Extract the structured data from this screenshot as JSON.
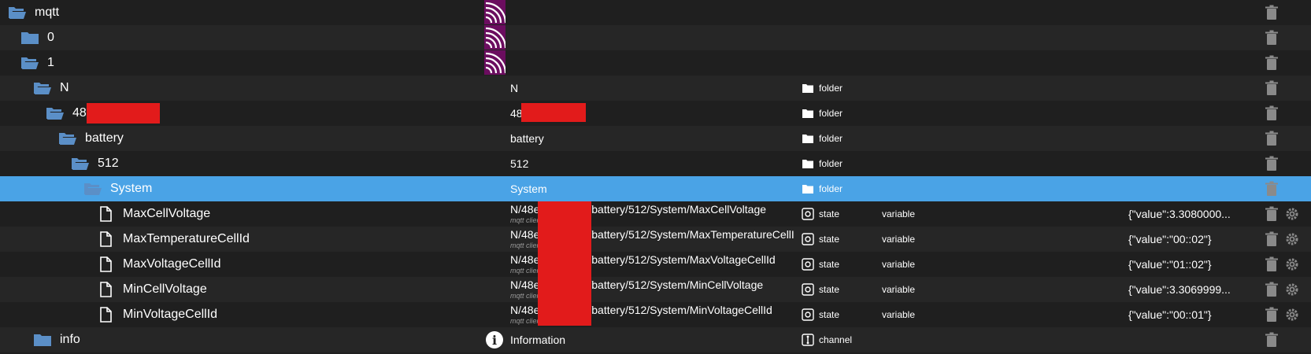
{
  "rows": [
    {
      "name": "mqtt",
      "indent": 0,
      "icon": "folder-open-icon",
      "id": "",
      "id_sub": "",
      "type": "",
      "role": "",
      "value": "",
      "badge": "mqtt"
    },
    {
      "name": "0",
      "indent": 1,
      "icon": "folder-closed-icon",
      "id": "",
      "id_sub": "",
      "type": "",
      "role": "",
      "value": "",
      "badge": "mqtt"
    },
    {
      "name": "1",
      "indent": 1,
      "icon": "folder-open-icon",
      "id": "",
      "id_sub": "",
      "type": "",
      "role": "",
      "value": "",
      "badge": "mqtt"
    },
    {
      "name": "N",
      "indent": 2,
      "icon": "folder-open-icon",
      "id": "N",
      "id_sub": "",
      "type": "folder",
      "role": "",
      "value": ""
    },
    {
      "name": "48",
      "indent": 3,
      "icon": "folder-open-icon",
      "id": "48",
      "id_sub": "",
      "type": "folder",
      "role": "",
      "value": ""
    },
    {
      "name": "battery",
      "indent": 4,
      "icon": "folder-open-icon",
      "id": "battery",
      "id_sub": "",
      "type": "folder",
      "role": "",
      "value": ""
    },
    {
      "name": "512",
      "indent": 5,
      "icon": "folder-open-icon",
      "id": "512",
      "id_sub": "",
      "type": "folder",
      "role": "",
      "value": ""
    },
    {
      "name": "System",
      "indent": 6,
      "icon": "folder-open-icon",
      "id": "System",
      "id_sub": "",
      "type": "folder",
      "role": "",
      "value": "",
      "selected": true
    },
    {
      "name": "MaxCellVoltage",
      "indent": 7,
      "icon": "file-icon",
      "id": "N/48e",
      "id_tail": "/battery/512/System/MaxCellVoltage",
      "id_sub": "mqtt client variable",
      "type": "state",
      "role": "variable",
      "value": "{\"value\":3.3080000..."
    },
    {
      "name": "MaxTemperatureCellId",
      "indent": 7,
      "icon": "file-icon",
      "id": "N/48e",
      "id_tail": "/battery/512/System/MaxTemperatureCellId",
      "id_sub": "mqtt client variable",
      "type": "state",
      "role": "variable",
      "value": "{\"value\":\"00::02\"}"
    },
    {
      "name": "MaxVoltageCellId",
      "indent": 7,
      "icon": "file-icon",
      "id": "N/48e",
      "id_tail": "/battery/512/System/MaxVoltageCellId",
      "id_sub": "mqtt client variable",
      "type": "state",
      "role": "variable",
      "value": "{\"value\":\"01::02\"}"
    },
    {
      "name": "MinCellVoltage",
      "indent": 7,
      "icon": "file-icon",
      "id": "N/48e",
      "id_tail": "/battery/512/System/MinCellVoltage",
      "id_sub": "mqtt client variable",
      "type": "state",
      "role": "variable",
      "value": "{\"value\":3.3069999..."
    },
    {
      "name": "MinVoltageCellId",
      "indent": 7,
      "icon": "file-icon",
      "id": "N/48e",
      "id_tail": "/battery/512/System/MinVoltageCellId",
      "id_sub": "mqtt client variable",
      "type": "state",
      "role": "variable",
      "value": "{\"value\":\"00::01\"}"
    },
    {
      "name": "info",
      "indent": 2,
      "icon": "folder-closed-icon",
      "id": "Information",
      "id_sub": "",
      "type": "channel",
      "role": "",
      "value": "",
      "badge": "info"
    }
  ],
  "colors": {
    "background": "#1f1f1f",
    "selected": "#4aa3e6",
    "folder": "#5b8fc7",
    "mqtt": "#6b0d5f",
    "redaction": "#e21b1b"
  }
}
